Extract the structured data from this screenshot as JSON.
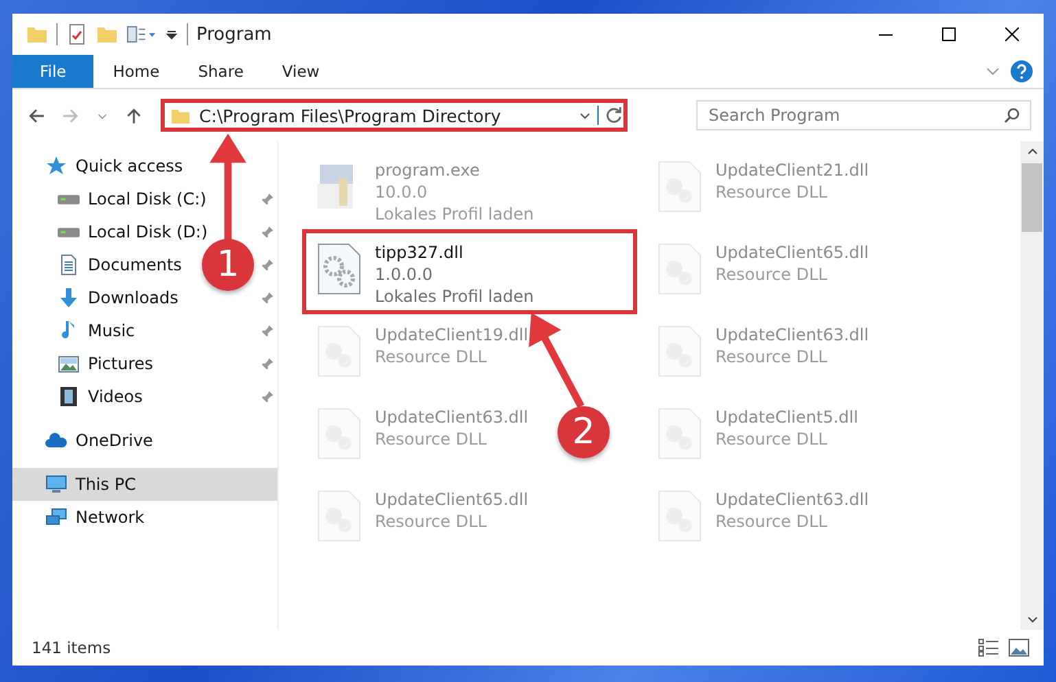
{
  "window": {
    "title": "Program"
  },
  "ribbon_tabs": [
    {
      "label": "File",
      "selected": true
    },
    {
      "label": "Home",
      "selected": false
    },
    {
      "label": "Share",
      "selected": false
    },
    {
      "label": "View",
      "selected": false
    }
  ],
  "address": {
    "path": "C:\\Program Files\\Program Directory",
    "highlighted": true
  },
  "search": {
    "placeholder": "Search Program"
  },
  "sidebar": {
    "items": [
      {
        "label": "Quick access",
        "kind": "star",
        "pinned": false,
        "selected": false,
        "children": [
          {
            "label": "Local Disk (C:)",
            "kind": "drive",
            "pinned": true,
            "selected": false
          },
          {
            "label": "Local Disk (D:)",
            "kind": "drive",
            "pinned": true,
            "selected": false
          },
          {
            "label": "Documents",
            "kind": "document",
            "pinned": true,
            "selected": false
          },
          {
            "label": "Downloads",
            "kind": "download",
            "pinned": true,
            "selected": false
          },
          {
            "label": "Music",
            "kind": "music",
            "pinned": true,
            "selected": false
          },
          {
            "label": "Pictures",
            "kind": "image",
            "pinned": true,
            "selected": false
          },
          {
            "label": "Videos",
            "kind": "film",
            "pinned": true,
            "selected": false
          }
        ]
      },
      {
        "label": "OneDrive",
        "kind": "cloud",
        "pinned": false,
        "selected": false
      },
      {
        "label": "This PC",
        "kind": "monitor",
        "pinned": false,
        "selected": true
      },
      {
        "label": "Network",
        "kind": "network",
        "pinned": false,
        "selected": false
      }
    ]
  },
  "files": [
    {
      "name": "program.exe",
      "details": [
        "10.0.0",
        "Lokales Profil laden"
      ],
      "kind": "exe",
      "dimmed": true,
      "highlighted": false
    },
    {
      "name": "UpdateClient21.dll",
      "details": [
        "Resource DLL"
      ],
      "kind": "dll",
      "dimmed": true,
      "highlighted": false
    },
    {
      "name": "tipp327.dll",
      "details": [
        "1.0.0.0",
        "Lokales Profil laden"
      ],
      "kind": "gears",
      "dimmed": false,
      "highlighted": true
    },
    {
      "name": "UpdateClient65.dll",
      "details": [
        "Resource DLL"
      ],
      "kind": "dll",
      "dimmed": true,
      "highlighted": false
    },
    {
      "name": "UpdateClient19.dll",
      "details": [
        "Resource DLL"
      ],
      "kind": "dll",
      "dimmed": true,
      "highlighted": false
    },
    {
      "name": "UpdateClient63.dll",
      "details": [
        "Resource DLL"
      ],
      "kind": "dll",
      "dimmed": true,
      "highlighted": false
    },
    {
      "name": "UpdateClient63.dll",
      "details": [
        "Resource DLL"
      ],
      "kind": "dll",
      "dimmed": true,
      "highlighted": false
    },
    {
      "name": "UpdateClient5.dll",
      "details": [
        "Resource DLL"
      ],
      "kind": "dll",
      "dimmed": true,
      "highlighted": false
    },
    {
      "name": "UpdateClient65.dll",
      "details": [
        "Resource DLL"
      ],
      "kind": "dll",
      "dimmed": true,
      "highlighted": false
    },
    {
      "name": "UpdateClient63.dll",
      "details": [
        "Resource DLL"
      ],
      "kind": "dll",
      "dimmed": true,
      "highlighted": false
    }
  ],
  "annotations": [
    {
      "number": "1"
    },
    {
      "number": "2"
    }
  ],
  "status_bar": {
    "item_count": "141 items"
  }
}
